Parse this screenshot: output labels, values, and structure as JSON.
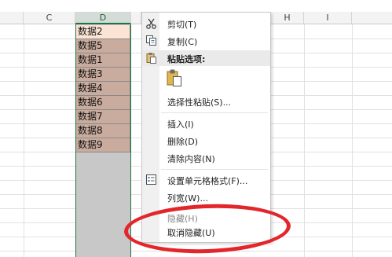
{
  "columns": {
    "c": "C",
    "d": "D",
    "h": "H",
    "i": "I"
  },
  "cells": [
    "数据2",
    "数据5",
    "数据1",
    "数据3",
    "数据4",
    "数据6",
    "数据7",
    "数据8",
    "数据9"
  ],
  "menu": {
    "cut": "剪切(T)",
    "copy": "复制(C)",
    "paste_options": "粘贴选项:",
    "paste_special": "选择性粘贴(S)...",
    "insert": "插入(I)",
    "delete": "删除(D)",
    "clear_contents": "清除内容(N)",
    "format_cells": "设置单元格格式(F)...",
    "column_width": "列宽(W)...",
    "hide": "隐藏(H)",
    "unhide": "取消隐藏(U)"
  },
  "icons": {
    "cut": "scissors-icon",
    "copy": "copy-icon",
    "paste": "clipboard-icon",
    "paste_option": "paste-clipboard-icon",
    "format": "format-cells-icon"
  },
  "colors": {
    "selection_accent": "#217346",
    "cell_fill": "#c9ac9e",
    "active_cell_fill": "#fbe4d5",
    "highlight_oval": "#e3262b"
  }
}
